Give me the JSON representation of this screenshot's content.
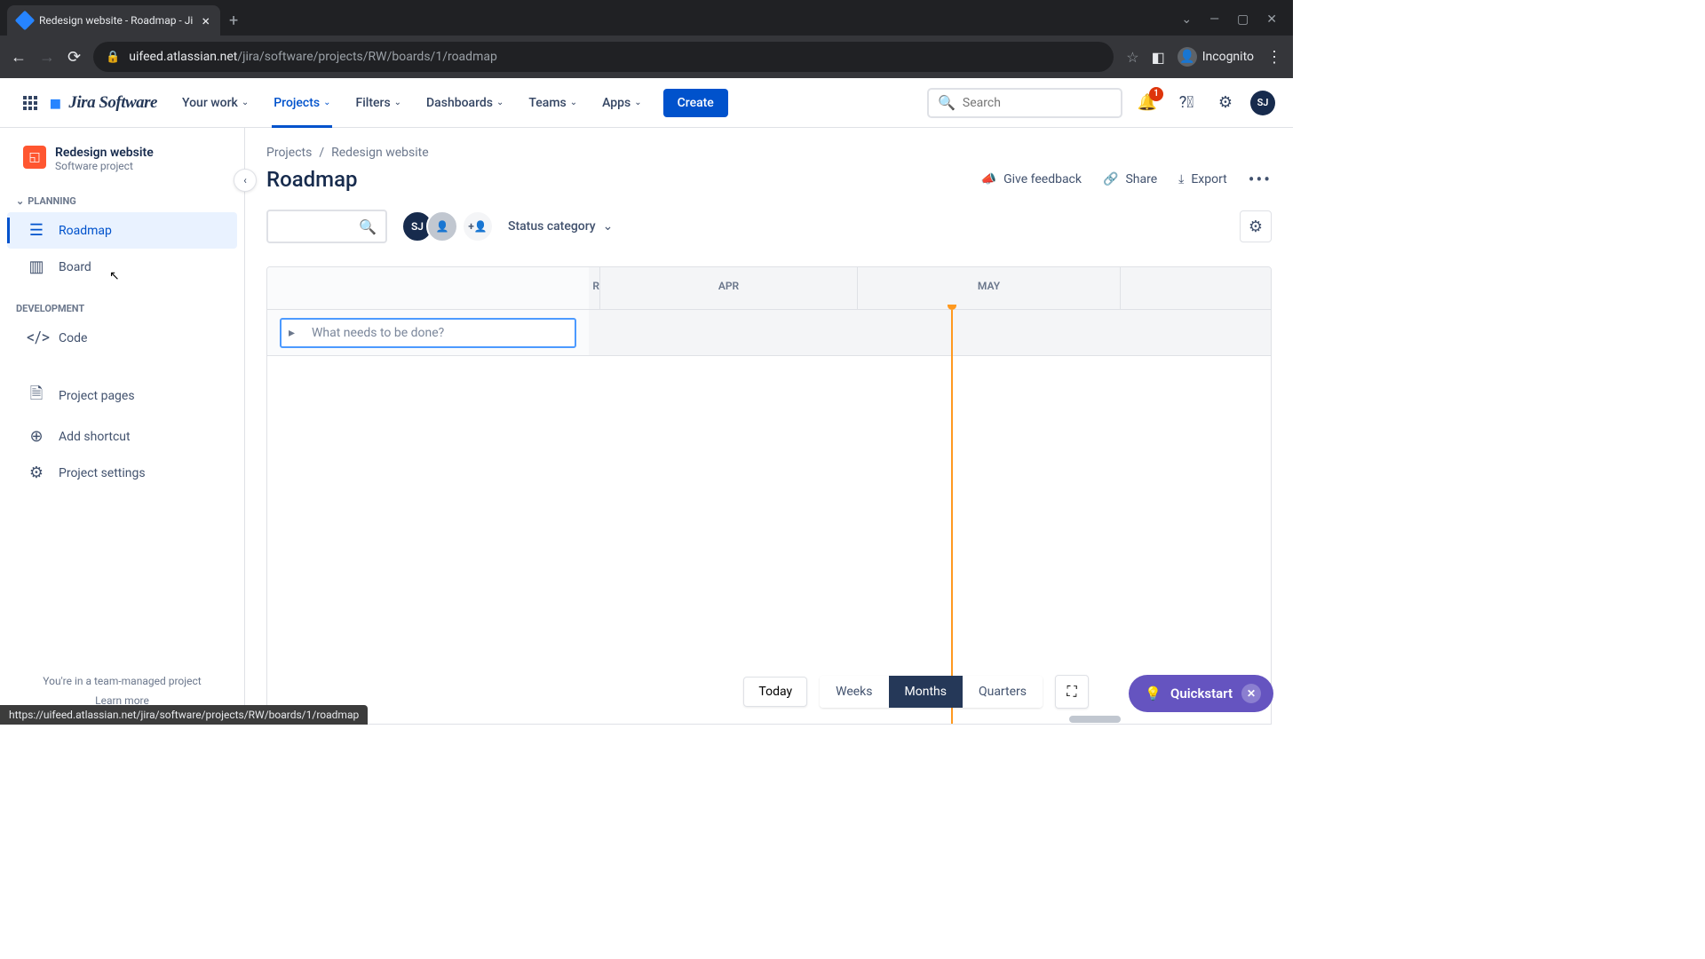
{
  "browser": {
    "tab_title": "Redesign website - Roadmap - Ji",
    "url_host": "uifeed.atlassian.net",
    "url_path": "/jira/software/projects/RW/boards/1/roadmap",
    "incognito_label": "Incognito"
  },
  "header": {
    "logo": "Jira Software",
    "nav": [
      {
        "label": "Your work"
      },
      {
        "label": "Projects",
        "active": true
      },
      {
        "label": "Filters"
      },
      {
        "label": "Dashboards"
      },
      {
        "label": "Teams"
      },
      {
        "label": "Apps"
      }
    ],
    "create": "Create",
    "search_placeholder": "Search",
    "notif_count": "1",
    "avatar": "SJ"
  },
  "sidebar": {
    "project_name": "Redesign website",
    "project_type": "Software project",
    "sections": {
      "planning": "PLANNING",
      "development": "DEVELOPMENT"
    },
    "items": {
      "roadmap": "Roadmap",
      "board": "Board",
      "code": "Code",
      "pages": "Project pages",
      "shortcut": "Add shortcut",
      "settings": "Project settings"
    },
    "footer1": "You're in a team-managed project",
    "footer2": "Learn more"
  },
  "page": {
    "breadcrumb": [
      "Projects",
      "Redesign website"
    ],
    "title": "Roadmap",
    "actions": {
      "feedback": "Give feedback",
      "share": "Share",
      "export": "Export"
    },
    "status_filter": "Status category",
    "avatar_me": "SJ",
    "epic_placeholder": "What needs to be done?",
    "months": [
      "R",
      "APR",
      "MAY"
    ],
    "controls": {
      "today": "Today",
      "weeks": "Weeks",
      "months": "Months",
      "quarters": "Quarters"
    }
  },
  "quickstart": "Quickstart",
  "status_url": "https://uifeed.atlassian.net/jira/software/projects/RW/boards/1/roadmap"
}
